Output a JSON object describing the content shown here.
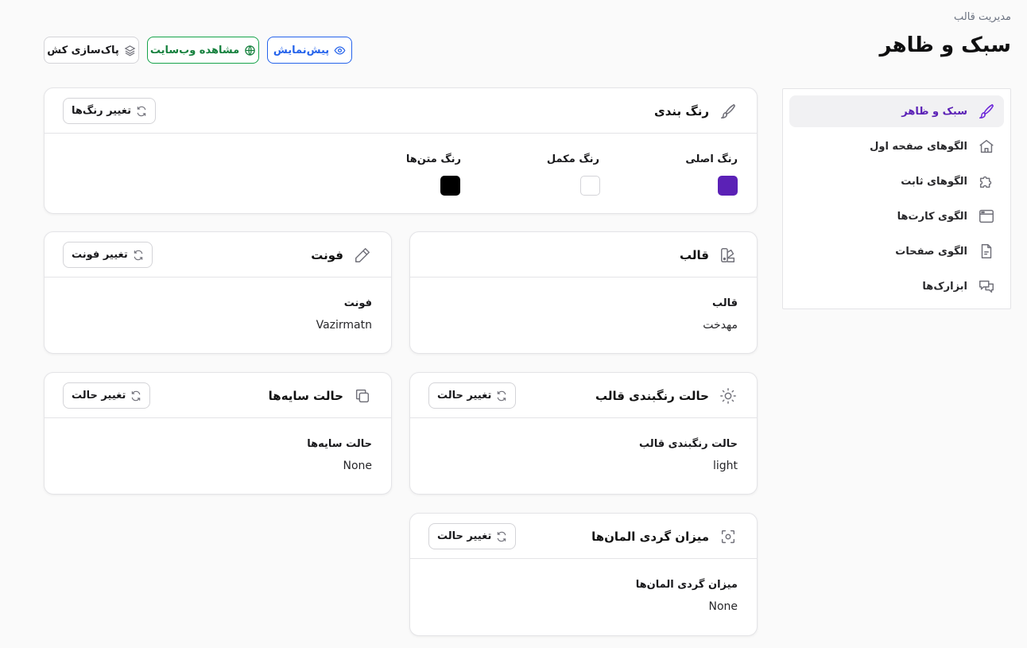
{
  "header": {
    "breadcrumb": "مدیریت قالب",
    "title": "سبک و ظاهر",
    "preview_label": "پیش‌نمایش",
    "website_label": "مشاهده وب‌سایت",
    "purge_label": "پاک‌سازی کش"
  },
  "sidebar": {
    "items": [
      {
        "label": "سبک و ظاهر",
        "icon": "brush-icon",
        "active": true
      },
      {
        "label": "الگوهای صفحه اول",
        "icon": "home-icon"
      },
      {
        "label": "الگوهای ثابت",
        "icon": "puzzle-icon"
      },
      {
        "label": "الگوی کارت‌ها",
        "icon": "browser-window-icon"
      },
      {
        "label": "الگوی صفحات",
        "icon": "document-icon"
      },
      {
        "label": "ابزارک‌ها",
        "icon": "chat-bubbles-icon"
      }
    ]
  },
  "colors_card": {
    "title": "رنگ بندی",
    "button_label": "تغییر رنگ‌ها",
    "swatches": [
      {
        "label": "رنگ اصلی",
        "color": "#5b21b6"
      },
      {
        "label": "رنگ مکمل",
        "color": "#ffffff"
      },
      {
        "label": "رنگ متن‌ها",
        "color": "#000000"
      }
    ]
  },
  "template_card": {
    "title": "قالب",
    "field_label": "قالب",
    "field_value": "مهدخت"
  },
  "font_card": {
    "title": "فونت",
    "button_label": "تغییر فونت",
    "field_label": "فونت",
    "field_value": "Vazirmatn"
  },
  "color_mode_card": {
    "title": "حالت رنگبندی قالب",
    "button_label": "تغییر حالت",
    "field_label": "حالت رنگبندی قالب",
    "field_value": "light"
  },
  "shadow_card": {
    "title": "حالت سایه‌ها",
    "button_label": "تغییر حالت",
    "field_label": "حالت سایه‌ها",
    "field_value": "None"
  },
  "radius_card": {
    "title": "میزان گردی المان‌ها",
    "button_label": "تغییر حالت",
    "field_label": "میزان گردی المان‌ها",
    "field_value": "None"
  },
  "theme": {
    "accent": "#6d28d9",
    "preview_color": "#2563eb",
    "website_color": "#16a34a"
  }
}
